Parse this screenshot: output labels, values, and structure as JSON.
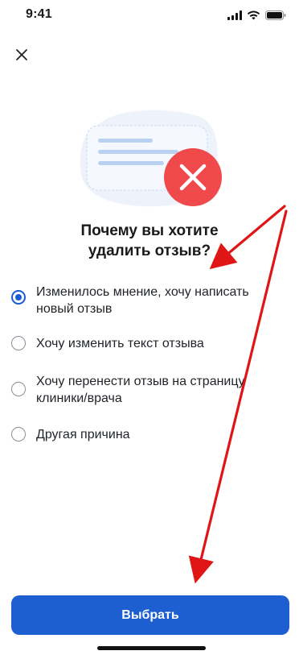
{
  "status_bar": {
    "time": "9:41",
    "icons": [
      "cellular-signal-icon",
      "wifi-icon",
      "battery-icon"
    ]
  },
  "header": {
    "close_icon": "close-icon"
  },
  "illustration": {
    "icon": "delete-review-illustration-icon",
    "accent_color": "#f0494b",
    "bubble_color": "#e8f0fb",
    "line_color": "#b9d2f2"
  },
  "title": {
    "line1": "Почему вы хотите",
    "line2": "удалить отзыв?"
  },
  "options": [
    {
      "line1": "Изменилось мнение, хочу написать",
      "line2": "новый отзыв",
      "selected": true
    },
    {
      "line1": "Хочу изменить текст отзыва",
      "line2": "",
      "selected": false
    },
    {
      "line1": "Хочу перенести отзыв на страницу",
      "line2": "клиники/врача",
      "selected": false
    },
    {
      "line1": "Другая причина",
      "line2": "",
      "selected": false
    }
  ],
  "primary_button": {
    "label": "Выбрать",
    "color": "#1d5fd1"
  },
  "colors": {
    "radio_selected": "#1a5bd6",
    "radio_unselected": "#8a8f98",
    "annotation_arrow": "#e01515"
  }
}
